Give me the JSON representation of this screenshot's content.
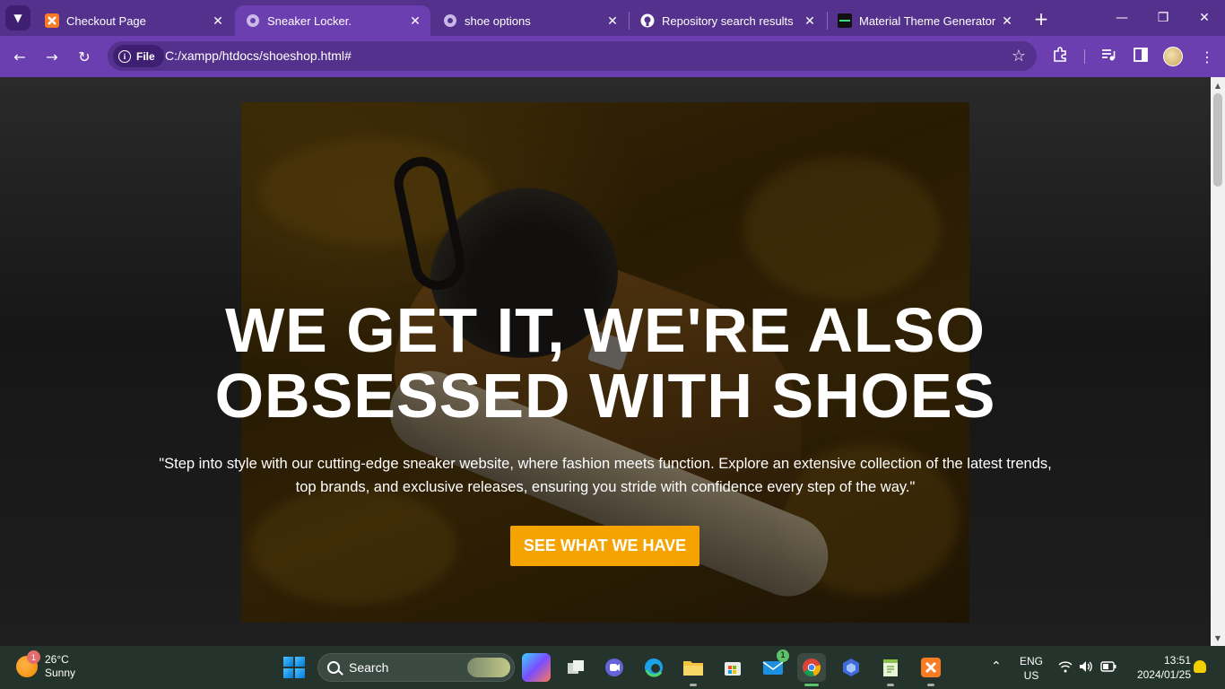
{
  "browser": {
    "tabs": [
      {
        "title": "Checkout Page",
        "icon": "xampp-icon",
        "active": false
      },
      {
        "title": "Sneaker Locker.",
        "icon": "globe-icon",
        "active": true
      },
      {
        "title": "shoe options",
        "icon": "globe-icon",
        "active": false
      },
      {
        "title": "Repository search results",
        "icon": "github-icon",
        "active": false
      },
      {
        "title": "Material Theme Generator",
        "icon": "mtg-icon",
        "active": false
      }
    ],
    "site_chip": "File",
    "url": "C:/xampp/htdocs/shoeshop.html#"
  },
  "page": {
    "headline_line1": "WE GET IT, WE'RE ALSO",
    "headline_line2": "OBSESSED WITH SHOES",
    "subtext": "\"Step into style with our cutting-edge sneaker website, where fashion meets function. Explore an extensive collection of the latest trends, top brands, and exclusive releases, ensuring you stride with confidence every step of the way.\"",
    "cta_label": "SEE WHAT WE HAVE",
    "accent_color": "#f5a300"
  },
  "taskbar": {
    "weather": {
      "temp": "26°C",
      "condition": "Sunny",
      "badge": "1"
    },
    "search_label": "Search",
    "mail_badge": "1",
    "language": "ENG",
    "region": "US",
    "time": "13:51",
    "date": "2024/01/25"
  },
  "colors": {
    "tab_strip": "#53318c",
    "toolbar": "#6b3fb0",
    "taskbar": "#24342c"
  }
}
